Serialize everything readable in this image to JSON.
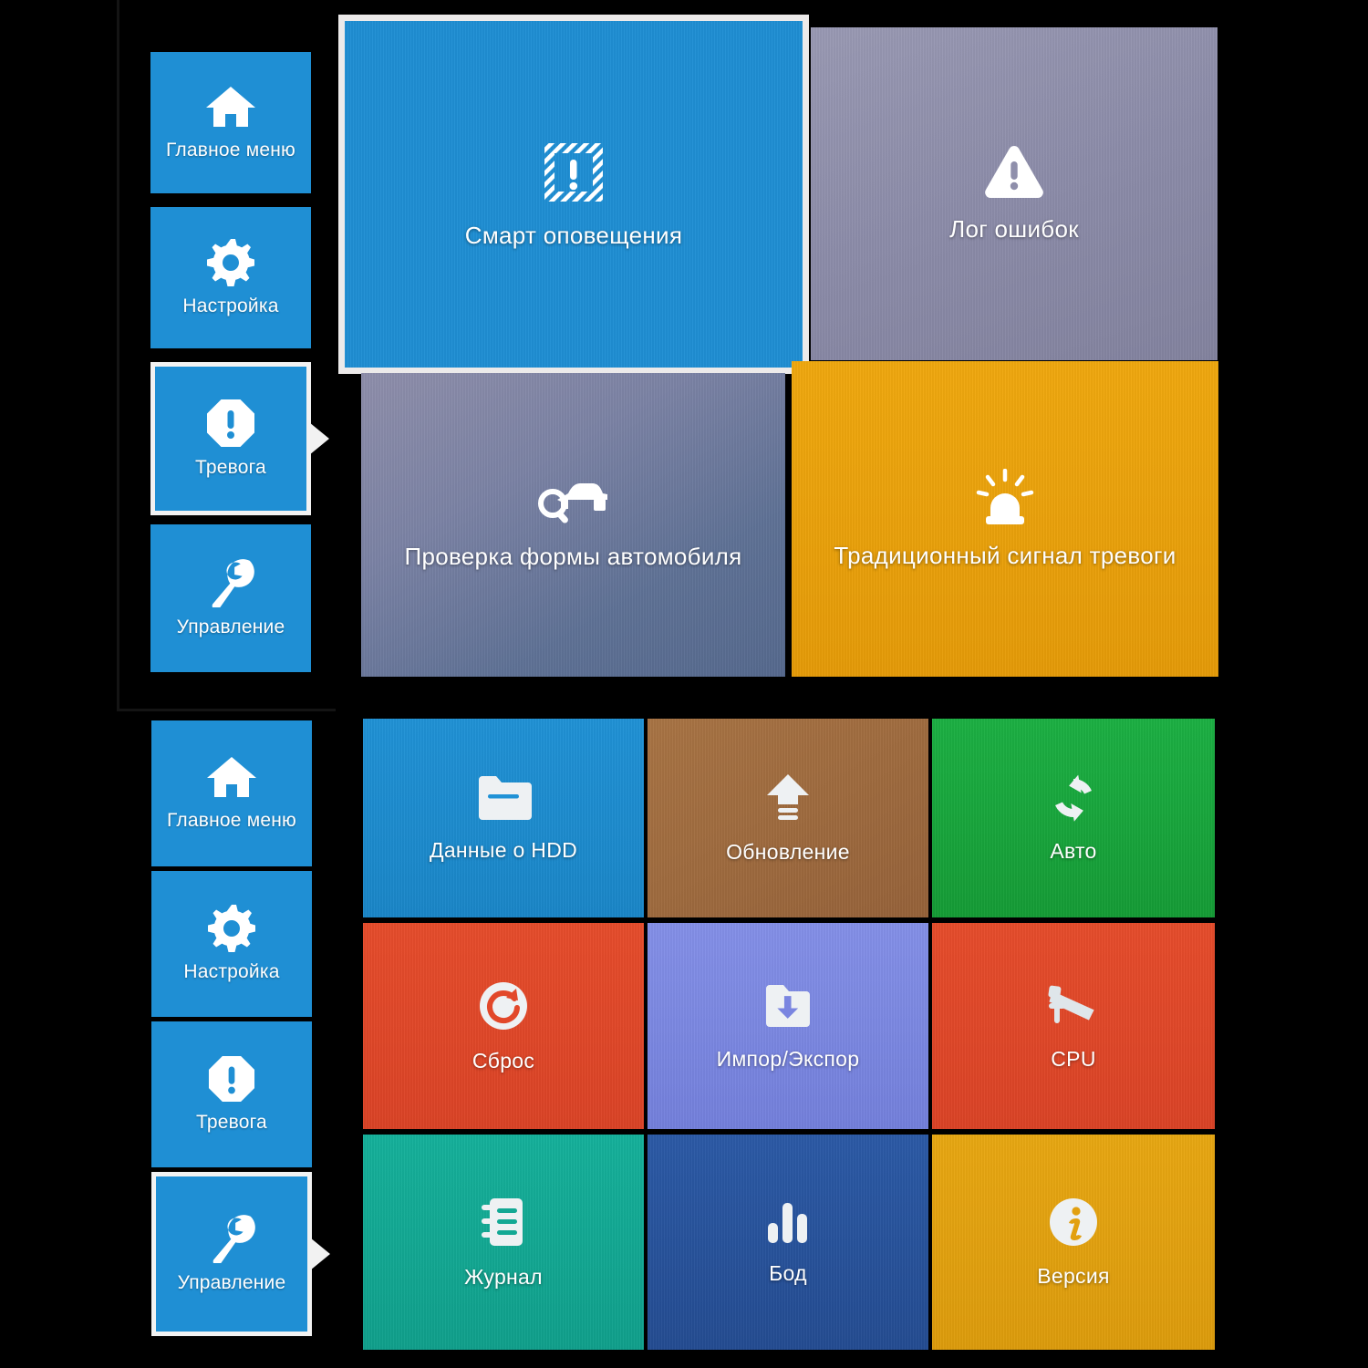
{
  "app": {
    "title": "DVR System Menu",
    "accent_blue": "#1f8fd4",
    "selected_border": "#f2f2f2"
  },
  "panel_top": {
    "name": "Alarm panel",
    "sidebar": {
      "items": [
        {
          "label": "Главное меню",
          "icon": "home-icon",
          "selected": false
        },
        {
          "label": "Настройка",
          "icon": "gear-icon",
          "selected": false
        },
        {
          "label": "Тревога",
          "icon": "alarm-octagon-icon",
          "selected": true
        },
        {
          "label": "Управление",
          "icon": "wrench-icon",
          "selected": false
        }
      ]
    },
    "tiles": [
      {
        "label": "Смарт оповещения",
        "icon": "smart-alert-icon",
        "color": "#1f8fd4",
        "selected": true
      },
      {
        "label": "Лог ошибок",
        "icon": "warning-triangle-icon",
        "color": "#8f8fab",
        "selected": false
      },
      {
        "label": "Проверка формы автомобиля",
        "icon": "car-search-icon",
        "color": "#6b7ba0",
        "selected": false
      },
      {
        "label": "Традиционный сигнал тревоги",
        "icon": "siren-icon",
        "color": "#eda30f",
        "selected": false
      }
    ]
  },
  "panel_bottom": {
    "name": "Management panel",
    "sidebar": {
      "items": [
        {
          "label": "Главное меню",
          "icon": "home-icon",
          "selected": false
        },
        {
          "label": "Настройка",
          "icon": "gear-icon",
          "selected": false
        },
        {
          "label": "Тревога",
          "icon": "alarm-octagon-icon",
          "selected": false
        },
        {
          "label": "Управление",
          "icon": "wrench-icon",
          "selected": true
        }
      ]
    },
    "tiles": [
      {
        "label": "Данные о HDD",
        "icon": "folder-hdd-icon",
        "color": "#1f8fd4"
      },
      {
        "label": "Обновление",
        "icon": "upgrade-arrow-icon",
        "color": "#9c6b3f"
      },
      {
        "label": "Авто",
        "icon": "auto-refresh-icon",
        "color": "#1aa83c"
      },
      {
        "label": "Сброс",
        "icon": "reset-icon",
        "color": "#e2482a"
      },
      {
        "label": "Импор/Экспор",
        "icon": "folder-download-icon",
        "color": "#7a85e0"
      },
      {
        "label": "CPU",
        "icon": "cctv-camera-icon",
        "color": "#e2482a"
      },
      {
        "label": "Журнал",
        "icon": "notebook-icon",
        "color": "#13a894"
      },
      {
        "label": "Бод",
        "icon": "bar-chart-icon",
        "color": "#28539c"
      },
      {
        "label": "Версия",
        "icon": "info-circle-icon",
        "color": "#e2a010"
      }
    ]
  }
}
